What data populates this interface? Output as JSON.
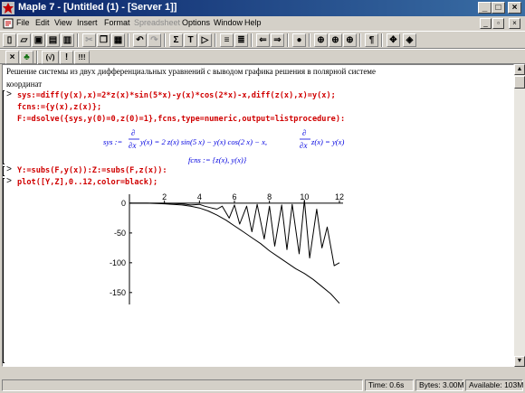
{
  "window": {
    "title": "Maple 7 - [Untitled (1) - [Server 1]]"
  },
  "menu": {
    "items": [
      "File",
      "Edit",
      "View",
      "Insert",
      "Format",
      "Spreadsheet",
      "Options",
      "Window",
      "Help"
    ]
  },
  "toolbar2": {
    "math_mode_label": "(√)",
    "exec_label": "!",
    "exec_all_label": "!!!"
  },
  "worksheet": {
    "description_line1": "Решение системы из двух дифференциальных уравнений с выводом графика решения в полярной системе",
    "description_line2": "координат",
    "cmd1": "sys:=diff(y(x),x)=2*z(x)*sin(5*x)-y(x)*cos(2*x)-x,diff(z(x),x)=y(x);",
    "cmd2": "fcns:={y(x),z(x)};",
    "cmd3": "F:=dsolve({sys,y(0)=0,z(0)=1},fcns,type=numeric,output=listprocedure):",
    "out_sys_lhs": "sys :=",
    "out_sys_rhs1": "y(x) = 2 z(x) sin(5 x) − y(x) cos(2 x) − x,",
    "out_sys_rhs2": "z(x) = y(x)",
    "out_fcns": "fcns := {z(x), y(x)}",
    "cmd4": "Y:=subs(F,y(x)):Z:=subs(F,z(x)):",
    "cmd5": "plot([Y,Z],0..12,color=black);"
  },
  "status": {
    "time": "Time:  0.6s",
    "bytes": "Bytes: 3.00M",
    "available": "Available: 103M"
  },
  "chart_data": {
    "type": "line",
    "x_ticks": [
      "2",
      "4",
      "6",
      "8",
      "10",
      "12"
    ],
    "y_ticks": [
      "0",
      "-50",
      "-100",
      "-150"
    ],
    "xlim": [
      0,
      12
    ],
    "ylim": [
      -170,
      15
    ],
    "grid": false,
    "series": [
      {
        "x": [
          0,
          1,
          2,
          3,
          3.5,
          4,
          4.5,
          5,
          5.5,
          6,
          6.5,
          7,
          7.5,
          8,
          8.5,
          9,
          9.5,
          10,
          10.5,
          11,
          11.5,
          12
        ],
        "values": [
          0,
          0,
          -1,
          -3,
          -5,
          -8,
          -13,
          -20,
          -28,
          -38,
          -48,
          -58,
          -68,
          -80,
          -90,
          -100,
          -110,
          -118,
          -128,
          -140,
          -152,
          -168
        ]
      },
      {
        "x": [
          0,
          1,
          2,
          3,
          3.5,
          4,
          4.3,
          4.7,
          5,
          5.3,
          5.7,
          6,
          6.3,
          6.7,
          7,
          7.3,
          7.7,
          8,
          8.3,
          8.7,
          9,
          9.3,
          9.7,
          10,
          10.3,
          10.7,
          11,
          11.3,
          11.7,
          12
        ],
        "values": [
          0,
          0,
          0,
          -1,
          -3,
          -2,
          -5,
          -8,
          -10,
          -5,
          -25,
          -3,
          -35,
          -5,
          -48,
          -2,
          -60,
          -5,
          -72,
          -3,
          -78,
          -2,
          -85,
          5,
          -92,
          -10,
          -75,
          -40,
          -105,
          -100
        ]
      }
    ]
  },
  "colors": {
    "title_start": "#0a246a",
    "title_end": "#3a6ea5",
    "input": "#d00000",
    "output": "#0000e0",
    "chrome": "#d4d0c8"
  }
}
